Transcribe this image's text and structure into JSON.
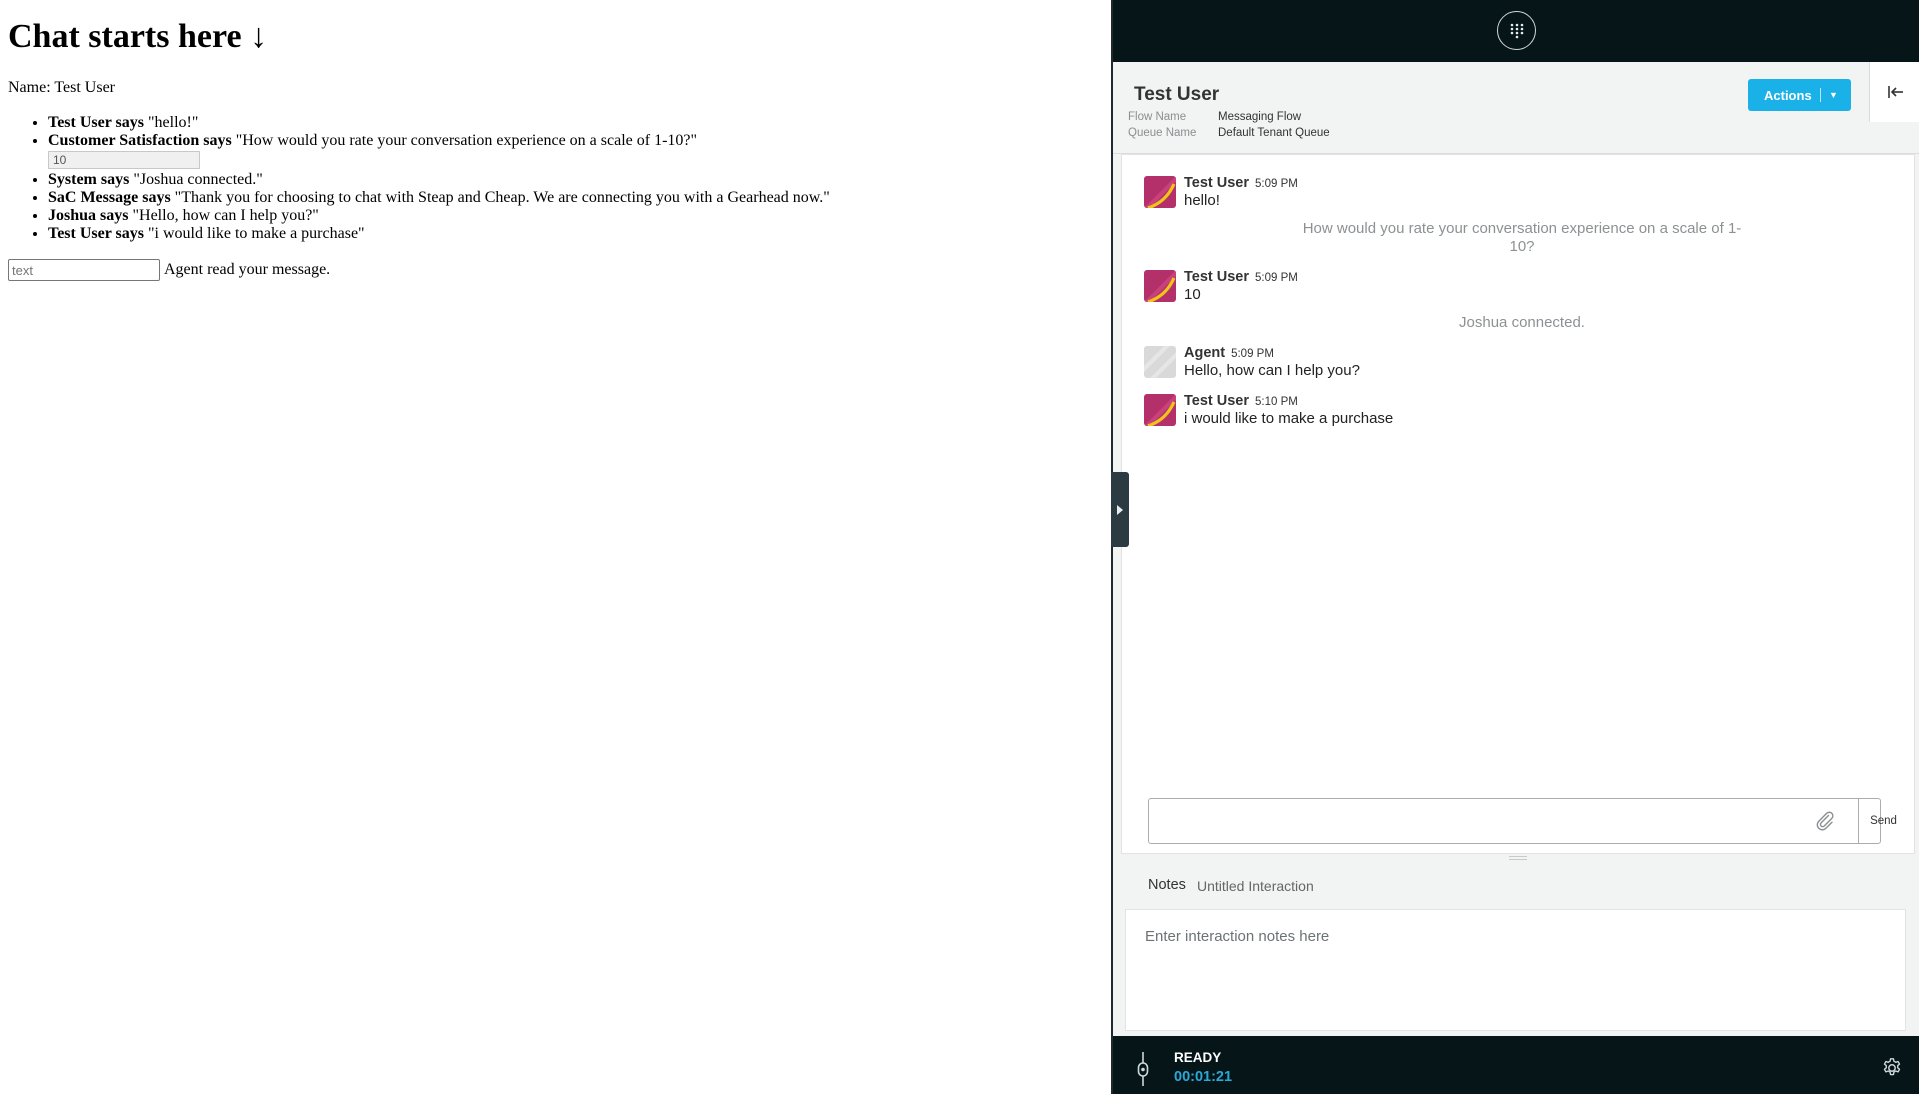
{
  "left_page": {
    "heading": "Chat starts here ↓",
    "name_line": "Name: Test User",
    "messages": [
      {
        "sender": "Test User says",
        "text": " \"hello!\""
      },
      {
        "sender": "Customer Satisfaction says",
        "text": " \"How would you rate your conversation experience on a scale of 1-10?\""
      },
      {
        "sender": "System says",
        "text": " \"Joshua connected.\""
      },
      {
        "sender": "SaC Message says",
        "text": " \"Thank you for choosing to chat with Steap and Cheap. We are connecting you with a Gearhead now.\""
      },
      {
        "sender": "Joshua says",
        "text": " \"Hello, how can I help you?\""
      },
      {
        "sender": "Test User says",
        "text": " \"i would like to make a purchase\""
      }
    ],
    "rating_value": "10",
    "text_input_placeholder": "text",
    "read_receipt": "Agent read your message."
  },
  "agent_panel": {
    "contact_name": "Test User",
    "flow_name_label": "Flow Name",
    "flow_name_value": "Messaging Flow",
    "queue_name_label": "Queue Name",
    "queue_name_value": "Default Tenant Queue",
    "actions_label": "Actions",
    "transcript": {
      "msg1": {
        "sender": "Test User",
        "time": "5:09 PM",
        "text": "hello!"
      },
      "survey_prompt": "How would you rate your conversation experience on a scale of 1-10?",
      "msg2": {
        "sender": "Test User",
        "time": "5:09 PM",
        "text": "10"
      },
      "connected_notice": "Joshua connected.",
      "msg3": {
        "sender": "Agent",
        "time": "5:09 PM",
        "text": "Hello, how can I help you?"
      },
      "msg4": {
        "sender": "Test User",
        "time": "5:10 PM",
        "text": "i would like to make a purchase"
      }
    },
    "send_label": "Send",
    "notes_label": "Notes",
    "notes_title": "Untitled Interaction",
    "notes_placeholder": "Enter interaction notes here",
    "status": "READY",
    "timer": "00:01:21"
  },
  "colors": {
    "topbar": "#061518",
    "accent": "#1ab0e8",
    "timer": "#2aa8d8"
  },
  "icons": [
    "dialpad-icon",
    "collapse-panel-icon",
    "paperclip-icon",
    "settings-gear-icon",
    "status-toggle-icon",
    "expand-arrow-icon",
    "user-avatar-icon"
  ]
}
